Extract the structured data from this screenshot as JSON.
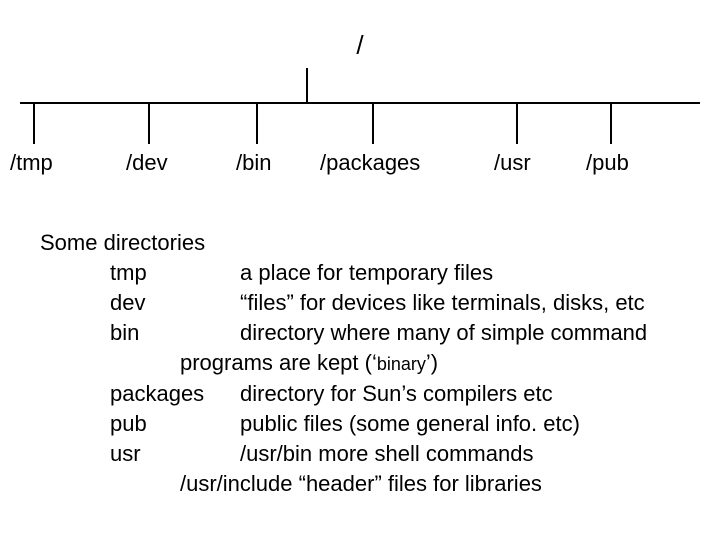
{
  "tree": {
    "root": "/",
    "children": [
      "/tmp",
      "/dev",
      "/bin",
      "/packages",
      "/usr",
      "/pub"
    ]
  },
  "caption": {
    "heading": "Some directories",
    "rows": [
      {
        "name": "tmp",
        "desc": "a place for temporary files"
      },
      {
        "name": "dev",
        "desc": "“files” for devices like terminals, disks, etc"
      },
      {
        "name": "bin",
        "desc": "directory where many of simple command"
      },
      {
        "name": "",
        "desc": "programs are kept (‘",
        "tail": "binary",
        "tail2": "’)"
      },
      {
        "name": "packages",
        "desc": "directory for Sun’s compilers etc"
      },
      {
        "name": "pub",
        "desc": "public files (some general info. etc)"
      },
      {
        "name": "usr",
        "desc": "/usr/bin  more shell commands"
      },
      {
        "name": "",
        "desc": "/usr/include   “header” files for libraries"
      }
    ]
  }
}
